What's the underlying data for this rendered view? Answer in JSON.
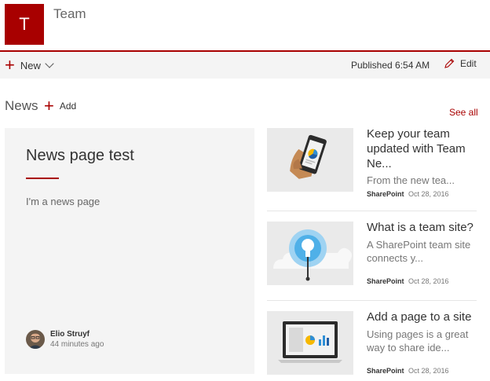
{
  "site": {
    "logo_letter": "T",
    "title": "Team"
  },
  "command_bar": {
    "new_label": "New",
    "published": "Published 6:54 AM",
    "edit_label": "Edit"
  },
  "news": {
    "title": "News",
    "add_label": "Add",
    "see_all": "See all",
    "hero": {
      "title": "News page test",
      "description": "I'm a news page",
      "author": "Elio Struyf",
      "time": "44 minutes ago"
    },
    "items": [
      {
        "title": "Keep your team updated with Team Ne...",
        "description": "From the new tea...",
        "source": "SharePoint",
        "date": "Oct 28, 2016",
        "icon": "phone-chart-icon"
      },
      {
        "title": "What is a team site?",
        "description": "A SharePoint team site connects y...",
        "source": "SharePoint",
        "date": "Oct 28, 2016",
        "icon": "lightbulb-cloud-icon"
      },
      {
        "title": "Add a page to a site",
        "description": "Using pages is a great way to share ide...",
        "source": "SharePoint",
        "date": "Oct 28, 2016",
        "icon": "laptop-chart-icon"
      }
    ]
  },
  "colors": {
    "accent": "#a80000",
    "panel": "#f4f4f4",
    "thumb": "#eaeaea"
  }
}
